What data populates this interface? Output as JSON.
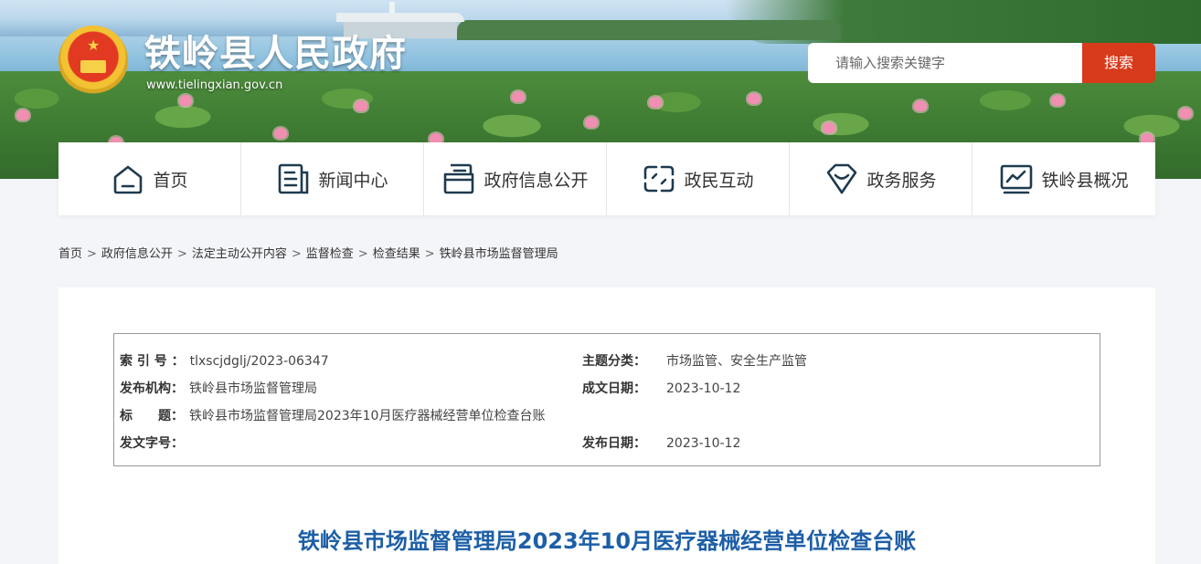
{
  "header": {
    "site_title": "铁岭县人民政府",
    "site_url": "www.tielingxian.gov.cn",
    "search_placeholder": "请输入搜索关键字",
    "search_button": "搜索"
  },
  "nav": {
    "items": [
      {
        "label": "首页",
        "icon": "home-icon"
      },
      {
        "label": "新闻中心",
        "icon": "news-icon"
      },
      {
        "label": "政府信息公开",
        "icon": "folder-icon"
      },
      {
        "label": "政民互动",
        "icon": "interaction-icon"
      },
      {
        "label": "政务服务",
        "icon": "service-icon"
      },
      {
        "label": "铁岭县概况",
        "icon": "overview-icon"
      }
    ]
  },
  "breadcrumb": {
    "items": [
      "首页",
      "政府信息公开",
      "法定主动公开内容",
      "监督检查",
      "检查结果",
      "铁岭县市场监督管理局"
    ],
    "separator": ">"
  },
  "meta": {
    "index_label": "索 引 号 ：",
    "index_value": "tlxscjdglj/2023-06347",
    "topic_label": "主题分类：",
    "topic_value": "市场监管、安全生产监管",
    "publisher_label": "发布机构：",
    "publisher_value": "铁岭县市场监督管理局",
    "created_label": "成文日期：",
    "created_value": "2023-10-12",
    "title_label": "标　　题：",
    "title_value": "铁岭县市场监督管理局2023年10月医疗器械经营单位检查台账",
    "docno_label": "发文字号：",
    "docno_value": "",
    "published_label": "发布日期：",
    "published_value": "2023-10-12"
  },
  "article": {
    "title": "铁岭县市场监督管理局2023年10月医疗器械经营单位检查台账"
  },
  "colors": {
    "accent_red": "#d83b1b",
    "title_blue": "#1d5fa6"
  }
}
